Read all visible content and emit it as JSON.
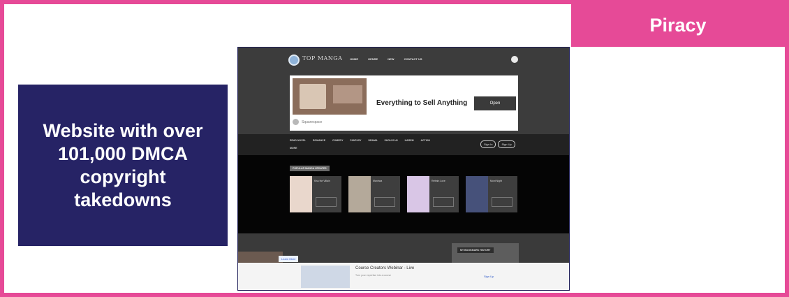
{
  "tag": "Piracy",
  "callout": "Website with over 101,000 DMCA copyright takedowns",
  "screenshot": {
    "logo": "TOP MANGA",
    "nav": [
      "HOME",
      "GENRE",
      "NEW",
      "CONTACT US"
    ],
    "ad": {
      "headline": "Everything to Sell Anything",
      "cta": "Open",
      "brand": "Squarespace"
    },
    "categories": [
      "READ NOVEL",
      "ROMANCE",
      "COMEDY",
      "FANTASY",
      "DRAMA",
      "SHOUJO AI",
      "HAREM",
      "ACTION"
    ],
    "more": "MORE",
    "auth": {
      "signin": "Sign In",
      "signup": "Sign Up"
    },
    "featured_label": "POPULAR MANGA UPDATES",
    "cards": [
      {
        "title": "Kiss the Villain",
        "cover": "#e9d7cc"
      },
      {
        "title": "Manhwa",
        "cover": "#b4a99a"
      },
      {
        "title": "Refrain Love",
        "cover": "#d9c6e6"
      },
      {
        "title": "Mont Night",
        "cover": "#46517a"
      }
    ],
    "side_label": "MY BOOKMARK HISTORY",
    "learn_more": "Learn More",
    "bottom_ad": {
      "title": "Course Creators Webinar - Live",
      "subtitle": "Turn your expertise into a course",
      "cta": "Sign Up"
    }
  }
}
